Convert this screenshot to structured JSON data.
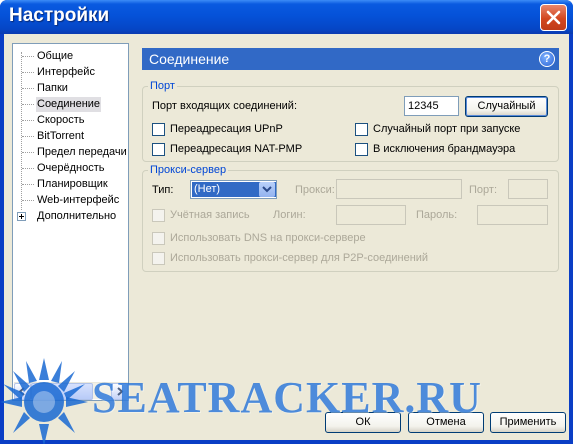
{
  "window": {
    "title": "Настройки"
  },
  "sidebar": {
    "items": [
      {
        "label": "Общие"
      },
      {
        "label": "Интерфейс"
      },
      {
        "label": "Папки"
      },
      {
        "label": "Соединение"
      },
      {
        "label": "Скорость"
      },
      {
        "label": "BitTorrent"
      },
      {
        "label": "Предел передачи"
      },
      {
        "label": "Очерёдность"
      },
      {
        "label": "Планировщик"
      },
      {
        "label": "Web-интерфейс"
      },
      {
        "label": "Дополнительно"
      }
    ],
    "selected": "Соединение"
  },
  "panel": {
    "title": "Соединение",
    "port_group": {
      "legend": "Порт",
      "incoming_label": "Порт входящих соединений:",
      "port_value": "12345",
      "random_button": "Случайный",
      "upnp_label": "Переадресация UPnP",
      "natpmp_label": "Переадресация NAT-PMP",
      "random_on_start_label": "Случайный порт при запуске",
      "firewall_label": "В исключения брандмауэра"
    },
    "proxy_group": {
      "legend": "Прокси-сервер",
      "type_label": "Тип:",
      "type_value": "(Нет)",
      "proxy_label": "Прокси:",
      "port_label": "Порт:",
      "auth_label": "Учётная запись",
      "login_label": "Логин:",
      "password_label": "Пароль:",
      "dns_label": "Использовать DNS на прокси-сервере",
      "p2p_label": "Использовать прокси-сервер для P2P-соединений"
    }
  },
  "footer": {
    "ok_label": "ОК",
    "cancel_label": "Отмена",
    "apply_label": "Применить"
  },
  "watermark": {
    "text": "SEATRACKER.RU"
  },
  "colors": {
    "titlebar": "#0552d9",
    "header": "#3169c6",
    "legend": "#0046d5",
    "dialog_bg": "#ece9d8",
    "close": "#d2461f"
  }
}
